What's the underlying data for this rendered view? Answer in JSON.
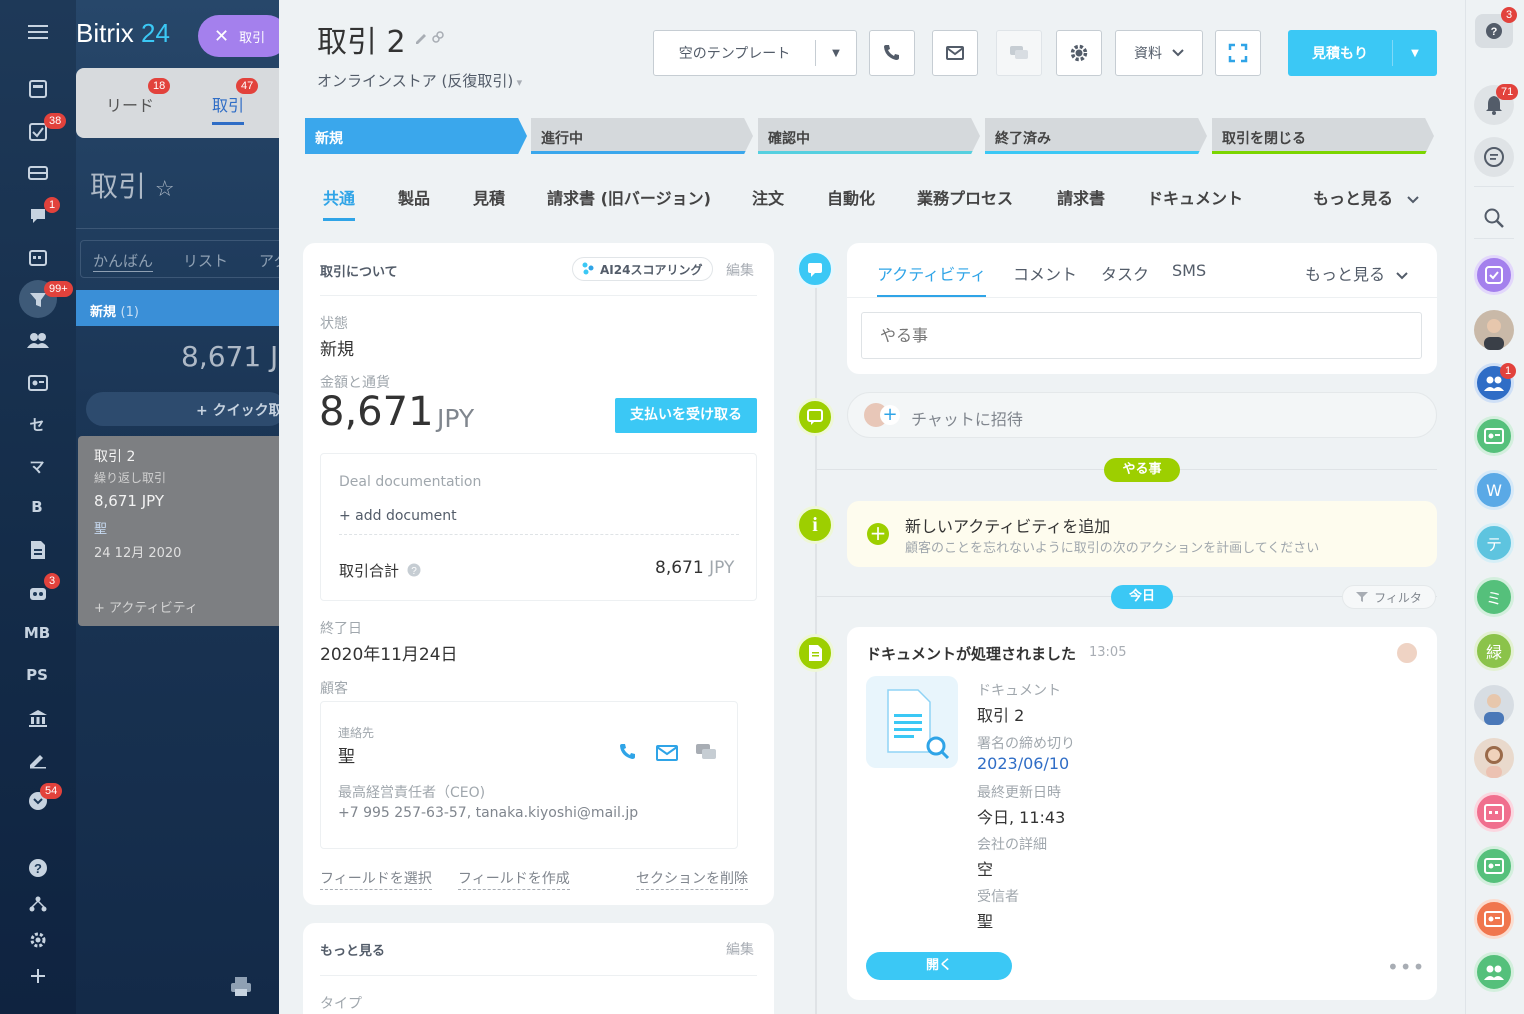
{
  "left_nav": {
    "brand": "Bitrix",
    "brand_num": "24",
    "badges": {
      "tasks": "38",
      "chat": "1",
      "crm": "99+",
      "robots": "3",
      "more": "54"
    },
    "text_items": [
      "セ",
      "マ",
      "B",
      "MB",
      "PS"
    ]
  },
  "kanban": {
    "close_chip": "取引",
    "tab_leads": "リード",
    "tab_leads_count": "18",
    "tab_deals": "取引",
    "tab_deals_count": "47",
    "title": "取引",
    "view_kanban": "かんばん",
    "view_list": "リスト",
    "view_more": "アク",
    "column_name": "新規",
    "column_count": "(1)",
    "column_sum": "8,671 J",
    "quick_add": "+ クイック取",
    "card_title": "取引 2",
    "card_sub": "繰り返し取引",
    "card_amount": "8,671 JPY",
    "card_client": "聖",
    "card_date": "24 12月 2020",
    "card_activity": "+ アクティビティ"
  },
  "header": {
    "title": "取引 2",
    "subtitle": "オンラインストア (反復取引)",
    "template_button": "空のテンプレート",
    "materials_button": "資料",
    "estimate_button": "見積もり"
  },
  "stages": [
    "新規",
    "進行中",
    "確認中",
    "終了済み",
    "取引を閉じる"
  ],
  "tabs": [
    "共通",
    "製品",
    "見積",
    "請求書 (旧バージョン)",
    "注文",
    "自動化",
    "業務プロセス",
    "請求書",
    "ドキュメント",
    "もっと見る"
  ],
  "about": {
    "section_title": "取引について",
    "ai_badge": "AI24スコアリング",
    "edit": "編集",
    "status_label": "状態",
    "status_value": "新規",
    "amount_label": "金額と通貨",
    "amount_value": "8,671",
    "amount_currency": "JPY",
    "pay_button": "支払いを受け取る",
    "doc_title": "Deal documentation",
    "add_document": "+ add document",
    "total_label": "取引合計",
    "total_value": "8,671",
    "total_currency": "JPY",
    "end_date_label": "終了日",
    "end_date_value": "2020年11月24日",
    "client_label": "顧客",
    "contact_label": "連絡先",
    "contact_name": "聖",
    "contact_role": "最高経営責任者（CEO)",
    "contact_info": "+7 995 257-63-57, tanaka.kiyoshi@mail.jp",
    "select_fields": "フィールドを選択",
    "create_field": "フィールドを作成",
    "delete_section": "セクションを削除"
  },
  "more_section": {
    "title": "もっと見る",
    "edit": "編集",
    "type_label": "タイプ"
  },
  "timeline": {
    "tabs": [
      "アクティビティ",
      "コメント",
      "タスク",
      "SMS",
      "もっと見る"
    ],
    "todo_placeholder": "やる事",
    "invite_chat": "チャットに招待",
    "todo_pill": "やる事",
    "add_activity_title": "新しいアクティビティを追加",
    "add_activity_sub": "顧客のことを忘れないように取引の次のアクションを計画してください",
    "today_pill": "今日",
    "filter": "フィルタ",
    "doc_event_title": "ドキュメントが処理されました",
    "doc_event_time": "13:05",
    "doc_type_label": "ドキュメント",
    "doc_type_value": "取引 2",
    "deadline_label": "署名の締め切り",
    "deadline_value": "2023/06/10",
    "updated_label": "最終更新日時",
    "updated_value": "今日, 11:43",
    "company_label": "会社の詳細",
    "company_value": "空",
    "recipient_label": "受信者",
    "recipient_value": "聖",
    "open_button": "開く"
  },
  "right_bar": {
    "help_badge": "3",
    "notif_badge": "71",
    "group_badge": "1",
    "avatars": [
      "W",
      "テ",
      "ミ",
      "緑"
    ]
  },
  "colors": {
    "accent_blue": "#3bc8f5",
    "stage_active": "#3aa7ec",
    "green": "#9dcf00",
    "nav_dark": "#1e3958",
    "badge_red": "#e2423c"
  }
}
